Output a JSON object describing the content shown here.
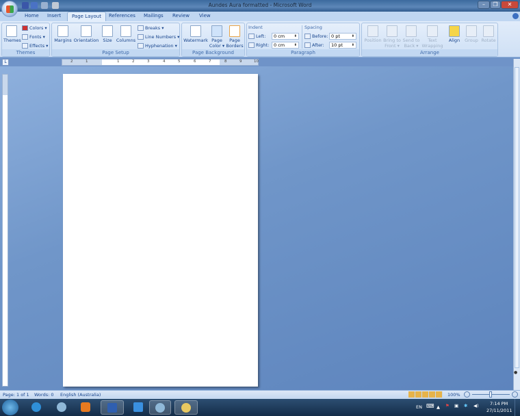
{
  "window": {
    "title": "Aundes Aura formatted - Microsoft Word",
    "minimize": "–",
    "restore": "❐",
    "close": "✕"
  },
  "tabs": [
    {
      "label": "Home"
    },
    {
      "label": "Insert"
    },
    {
      "label": "Page Layout",
      "active": true
    },
    {
      "label": "References"
    },
    {
      "label": "Mailings"
    },
    {
      "label": "Review"
    },
    {
      "label": "View"
    }
  ],
  "ribbon": {
    "themes": {
      "label": "Themes",
      "themes": "Themes",
      "colors": "Colors ▾",
      "fonts": "Fonts ▾",
      "effects": "Effects ▾"
    },
    "page_setup": {
      "label": "Page Setup",
      "margins": "Margins",
      "orientation": "Orientation",
      "size": "Size",
      "columns": "Columns",
      "breaks": "Breaks ▾",
      "line_numbers": "Line Numbers ▾",
      "hyphenation": "Hyphenation ▾"
    },
    "page_background": {
      "label": "Page Background",
      "watermark": "Watermark",
      "page_color": "Page Color ▾",
      "page_borders": "Page Borders"
    },
    "paragraph": {
      "label": "Paragraph",
      "indent": "Indent",
      "left_label": "Left:",
      "left_value": "0 cm",
      "right_label": "Right:",
      "right_value": "0 cm",
      "spacing": "Spacing",
      "before_label": "Before:",
      "before_value": "0 pt",
      "after_label": "After:",
      "after_value": "10 pt"
    },
    "arrange": {
      "label": "Arrange",
      "position": "Position",
      "bring_to_front": "Bring to Front ▾",
      "send_to_back": "Send to Back ▾",
      "text_wrapping": "Text Wrapping ▾",
      "align": "Align",
      "group": "Group",
      "rotate": "Rotate"
    }
  },
  "ruler": {
    "ticks": [
      "2",
      "1",
      "1",
      "2",
      "3",
      "4",
      "5",
      "6",
      "7",
      "8",
      "9",
      "10"
    ]
  },
  "status": {
    "page": "Page: 1 of 1",
    "words": "Words: 0",
    "language": "English (Australia)",
    "zoom": "100%"
  },
  "tray": {
    "lang": "EN",
    "time": "7:14 PM",
    "date": "27/11/2011"
  },
  "colors": {
    "ribbon": "#dbe8f7",
    "doc_bg": "#6f93c8",
    "taskbar": "#1c3858"
  }
}
